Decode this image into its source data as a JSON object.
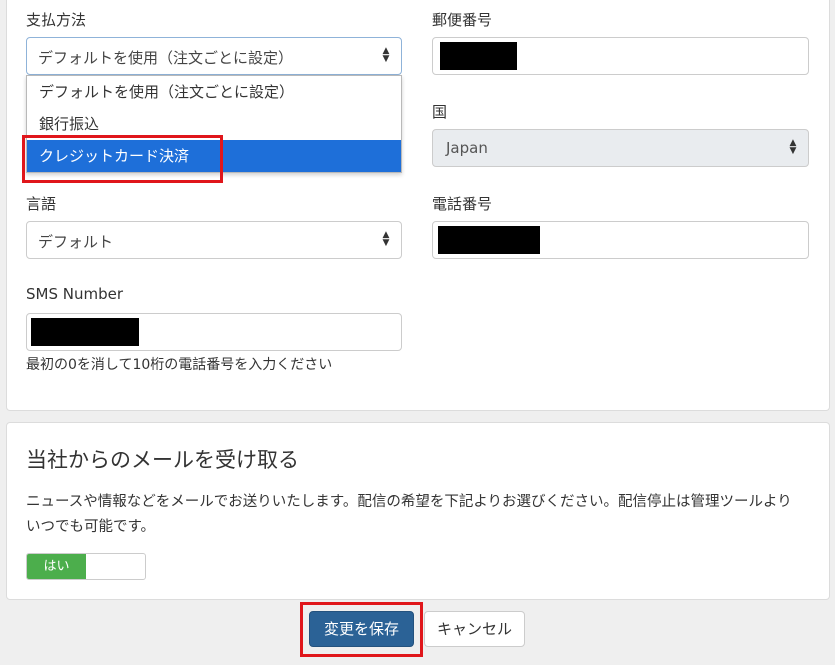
{
  "form": {
    "payment": {
      "label": "支払方法",
      "value": "デフォルトを使用（注文ごとに設定）",
      "options": [
        "デフォルトを使用（注文ごとに設定）",
        "銀行振込",
        "クレジットカード決済"
      ],
      "highlighted_option": "クレジットカード決済"
    },
    "postal": {
      "label": "郵便番号",
      "value": "[redacted]"
    },
    "country": {
      "label": "国",
      "value": "Japan"
    },
    "language": {
      "label": "言語",
      "value": "デフォルト"
    },
    "phone": {
      "label": "電話番号",
      "value": "[redacted]"
    },
    "sms": {
      "label": "SMS Number",
      "value": "[redacted]",
      "help": "最初の0を消して10桁の電話番号を入力ください"
    }
  },
  "mail_section": {
    "title": "当社からのメールを受け取る",
    "description": "ニュースや情報などをメールでお送りいたします。配信の希望を下記よりお選びください。配信停止は管理ツールよりいつでも可能です。",
    "toggle_label": "はい",
    "toggle_on": true
  },
  "actions": {
    "save": "変更を保存",
    "cancel": "キャンセル"
  },
  "colors": {
    "primary_button": "#2b6296",
    "dropdown_highlight": "#1e6fd9",
    "toggle_on": "#4cae4c",
    "annotation": "#e0161b"
  }
}
